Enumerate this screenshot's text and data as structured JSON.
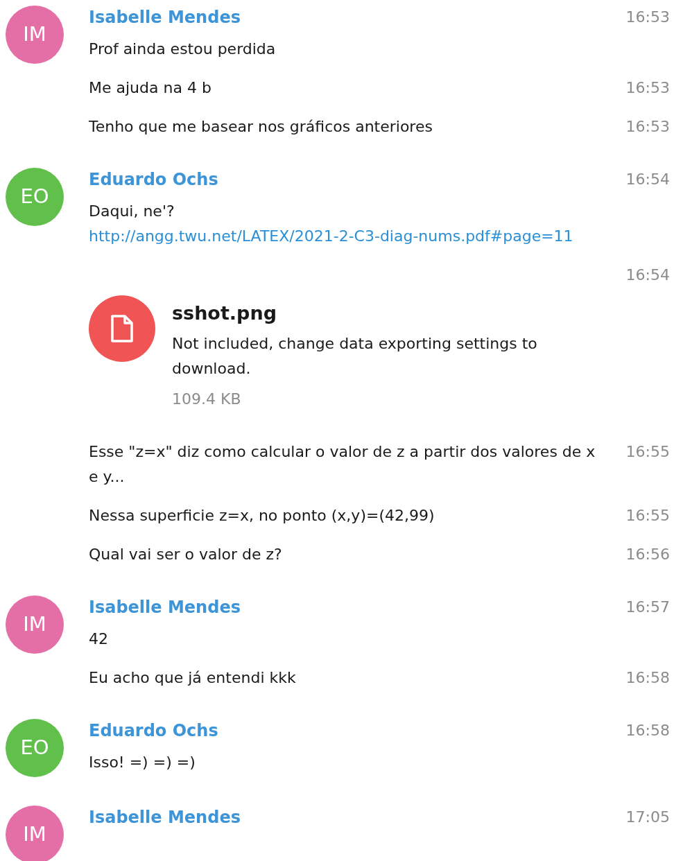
{
  "groups": [
    {
      "initials": "IM",
      "color": "#e46fa6",
      "name": "Isabelle Mendes",
      "time": "16:53",
      "messages": [
        {
          "kind": "text",
          "text": "Prof ainda estou perdida"
        },
        {
          "kind": "text",
          "text": "Me ajuda na 4 b",
          "time": "16:53"
        },
        {
          "kind": "text",
          "text": "Tenho que me basear nos gráficos anteriores",
          "time": "16:53"
        }
      ]
    },
    {
      "initials": "EO",
      "color": "#61c04c",
      "name": "Eduardo Ochs",
      "time": "16:54",
      "messages": [
        {
          "kind": "text_link",
          "text": "Daqui, ne'?",
          "link": "http://angg.twu.net/LATEX/2021-2-C3-diag-nums.pdf#page=11"
        },
        {
          "kind": "file",
          "time": "16:54",
          "file_name": "sshot.png",
          "note": "Not included, change data exporting settings to download.",
          "size": "109.4 KB"
        },
        {
          "kind": "text",
          "text": "Esse \"z=x\" diz como calcular o valor de z a partir dos valores de x e y...",
          "time": "16:55"
        },
        {
          "kind": "text",
          "text": "Nessa superficie z=x, no ponto (x,y)=(42,99)",
          "time": "16:55"
        },
        {
          "kind": "text",
          "text": "Qual vai ser o valor de z?",
          "time": "16:56"
        }
      ]
    },
    {
      "initials": "IM",
      "color": "#e46fa6",
      "name": "Isabelle Mendes",
      "time": "16:57",
      "messages": [
        {
          "kind": "text",
          "text": "42"
        },
        {
          "kind": "text",
          "text": "Eu acho que já entendi kkk",
          "time": "16:58"
        }
      ]
    },
    {
      "initials": "EO",
      "color": "#61c04c",
      "name": "Eduardo Ochs",
      "time": "16:58",
      "messages": [
        {
          "kind": "text",
          "text": "Isso! =) =) =)"
        }
      ]
    },
    {
      "initials": "IM",
      "color": "#e46fa6",
      "name": "Isabelle Mendes",
      "time": "17:05"
    }
  ]
}
